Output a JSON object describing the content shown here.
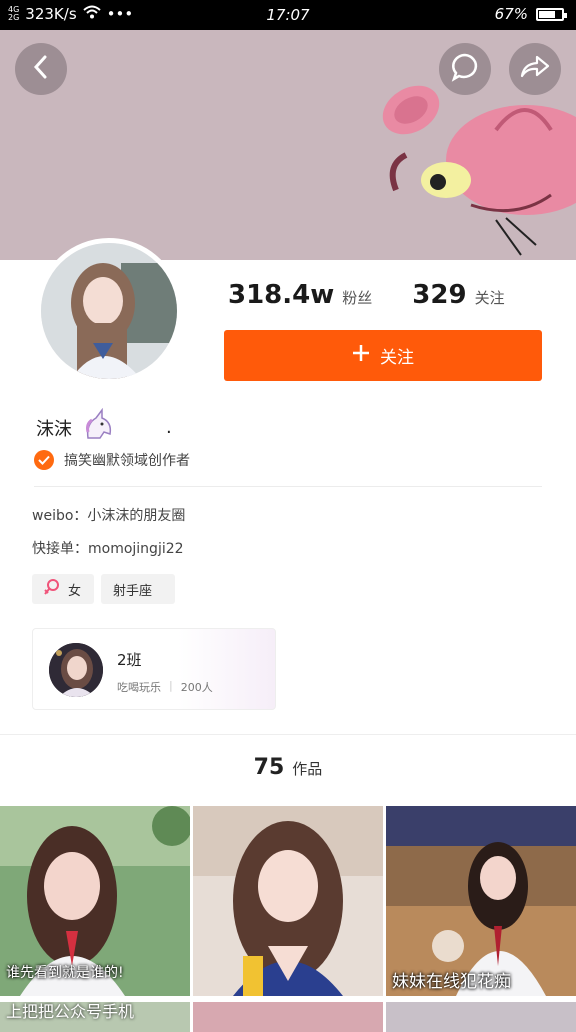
{
  "status_bar": {
    "network_top": "4G",
    "network_bottom": "2G",
    "speed": "323K/s",
    "more": "•••",
    "time": "17:07",
    "battery": "67%",
    "battery_level": 0.67
  },
  "profile": {
    "fans_count": "318.4w",
    "fans_label": "粉丝",
    "following_count": "329",
    "following_label": "关注",
    "follow_button": "关注",
    "name": "沫沫",
    "name_suffix": ".",
    "verified_text": "搞笑幽默领域创作者",
    "bio_weibo": "weibo：小沫沫的朋友圈",
    "bio_kuaishou": "快接单：momojingji22",
    "tag_gender": "女",
    "tag_zodiac": "射手座"
  },
  "group": {
    "title": "2班",
    "sub_tag": "吃喝玩乐",
    "sub_count": "200人"
  },
  "works": {
    "count": "75",
    "label": "作品"
  },
  "thumbnails": [
    {
      "caption": "谁先看到就是谁的!",
      "bottom_text": "上把把公众号手机"
    },
    {
      "caption": "",
      "bottom_text": ""
    },
    {
      "caption": "妹妹在线犯花痴",
      "bottom_text": ""
    }
  ],
  "colors": {
    "accent": "#ff5a0a",
    "banner": "#c9b7bd"
  }
}
